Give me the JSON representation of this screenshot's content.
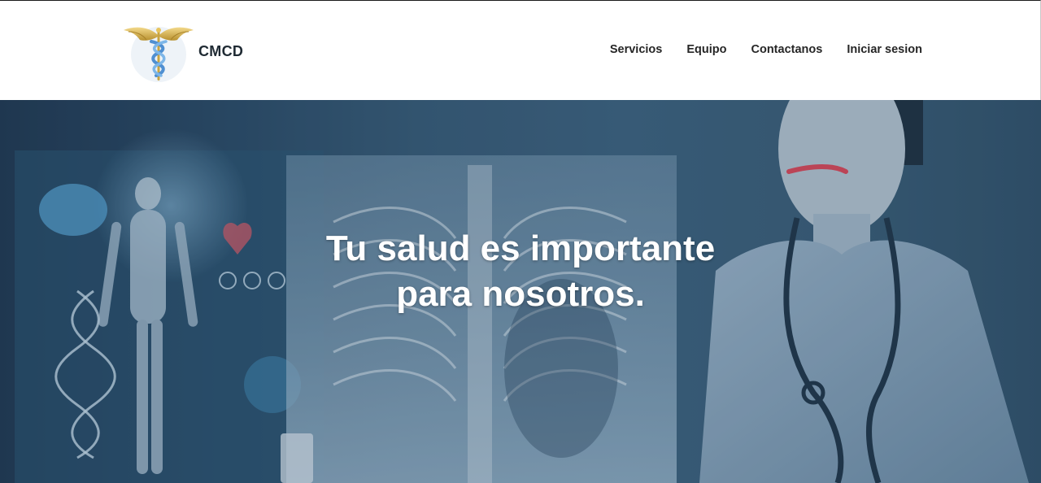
{
  "brand": {
    "name": "CMCD",
    "logo_icon": "caduceus-icon"
  },
  "nav": {
    "items": [
      {
        "label": "Servicios"
      },
      {
        "label": "Equipo"
      },
      {
        "label": "Contactanos"
      },
      {
        "label": "Iniciar sesion"
      }
    ]
  },
  "hero": {
    "title_line1": "Tu salud es importante",
    "title_line2": "para nosotros.",
    "background": "medical-hero-image"
  },
  "colors": {
    "nav_text": "#262626",
    "hero_base": "#395d78",
    "hero_title": "#ffffff"
  }
}
